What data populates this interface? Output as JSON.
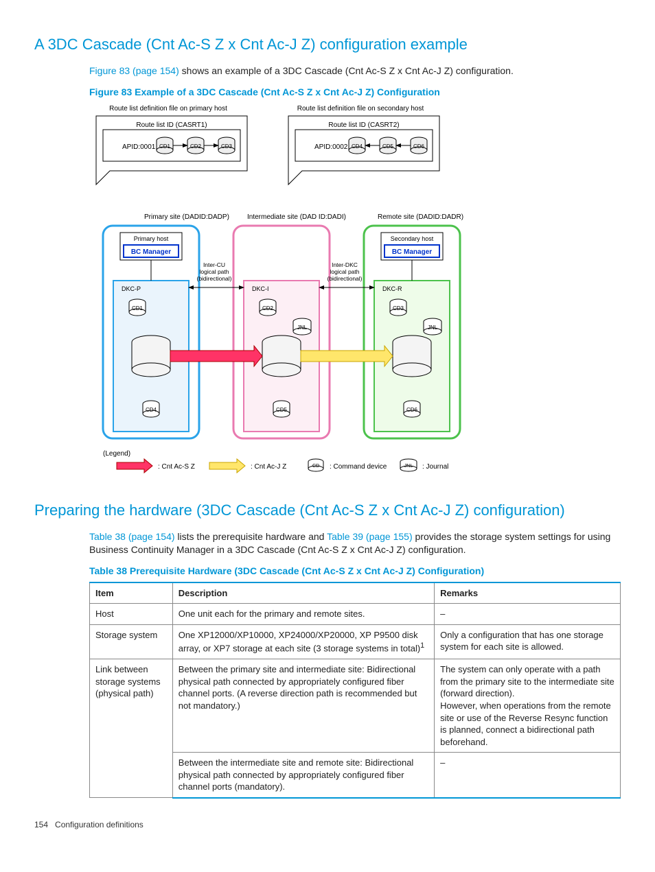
{
  "heading1": "A 3DC Cascade (Cnt Ac-S Z x Cnt Ac-J Z) configuration example",
  "intro1_link": "Figure 83 (page 154)",
  "intro1_rest": " shows an example of a 3DC Cascade (Cnt Ac-S Z x Cnt Ac-J Z) configuration.",
  "figure_caption": "Figure 83 Example of a 3DC Cascade (Cnt Ac-S Z x Cnt Ac-J Z) Configuration",
  "diagram": {
    "top": {
      "left_title": "Route list definition file on primary host",
      "left_id": "Route list ID (CASRT1)",
      "left_apid": "APID:0001",
      "left_cds": [
        "CD1",
        "CD2",
        "CD3"
      ],
      "right_title": "Route list definition file on secondary host",
      "right_id": "Route list ID (CASRT2)",
      "right_apid": "APID:0002",
      "right_cds": [
        "CD4",
        "CD5",
        "CD6"
      ]
    },
    "sites": {
      "primary_label": "Primary site (DADID:DADP)",
      "intermediate_label": "Intermediate site (DAD ID:DADI)",
      "remote_label": "Remote site (DADID:DADR)",
      "primary_host": "Primary host",
      "secondary_host": "Secondary host",
      "bc_manager": "BC Manager",
      "dkc_p": "DKC-P",
      "dkc_i": "DKC-I",
      "dkc_r": "DKC-R",
      "cd_labels": [
        "CD1",
        "CD2",
        "CD3",
        "CD4",
        "CD5",
        "CD6"
      ],
      "jnl": "JNL",
      "inter_cu": "Inter-CU\nlogical path\n(bidirectional)",
      "inter_dkc": "Inter-DKC\nlogical path\n(bidirectional)"
    },
    "legend": {
      "title": "(Legend)",
      "cntacsz": ": Cnt Ac-S Z",
      "cntacjz": ": Cnt Ac-J Z",
      "cd": ": Command device",
      "jnl": ": Journal",
      "cd_label": "CD",
      "jnl_label": "JNL"
    }
  },
  "heading2": "Preparing the hardware (3DC Cascade (Cnt Ac-S Z x Cnt Ac-J Z) configuration)",
  "intro2_prefix": "",
  "intro2_link1": "Table 38 (page 154)",
  "intro2_mid": " lists the prerequisite hardware and ",
  "intro2_link2": "Table 39 (page 155)",
  "intro2_rest": " provides the storage system settings for using Business Continuity Manager in a 3DC Cascade (Cnt Ac-S Z x Cnt Ac-J Z) configuration.",
  "table_caption": "Table 38 Prerequisite Hardware (3DC Cascade (Cnt Ac-S Z x Cnt Ac-J Z) Configuration)",
  "table": {
    "headers": [
      "Item",
      "Description",
      "Remarks"
    ],
    "rows": [
      {
        "item": "Host",
        "desc": "One unit each for the primary and remote sites.",
        "remarks": "–"
      },
      {
        "item": "Storage system",
        "desc": "One XP12000/XP10000, XP24000/XP20000, XP P9500 disk array, or XP7 storage at each site (3 storage systems in total)",
        "desc_sup": "1",
        "remarks": "Only a configuration that has one storage system for each site is allowed."
      },
      {
        "item": "Link between storage systems (physical path)",
        "desc": "Between the primary site and intermediate site: Bidirectional physical path connected by appropriately configured fiber channel ports. (A reverse direction path is recommended but not mandatory.)",
        "remarks": "The system can only operate with a path from the primary site to the intermediate site (forward direction).\nHowever, when operations from the remote site or use of the Reverse Resync function is planned, connect a bidirectional path beforehand."
      },
      {
        "item": "",
        "desc": "Between the intermediate site and remote site: Bidirectional physical path connected by appropriately configured fiber channel ports (mandatory).",
        "remarks": "–"
      }
    ]
  },
  "footer_page": "154",
  "footer_text": "Configuration definitions"
}
